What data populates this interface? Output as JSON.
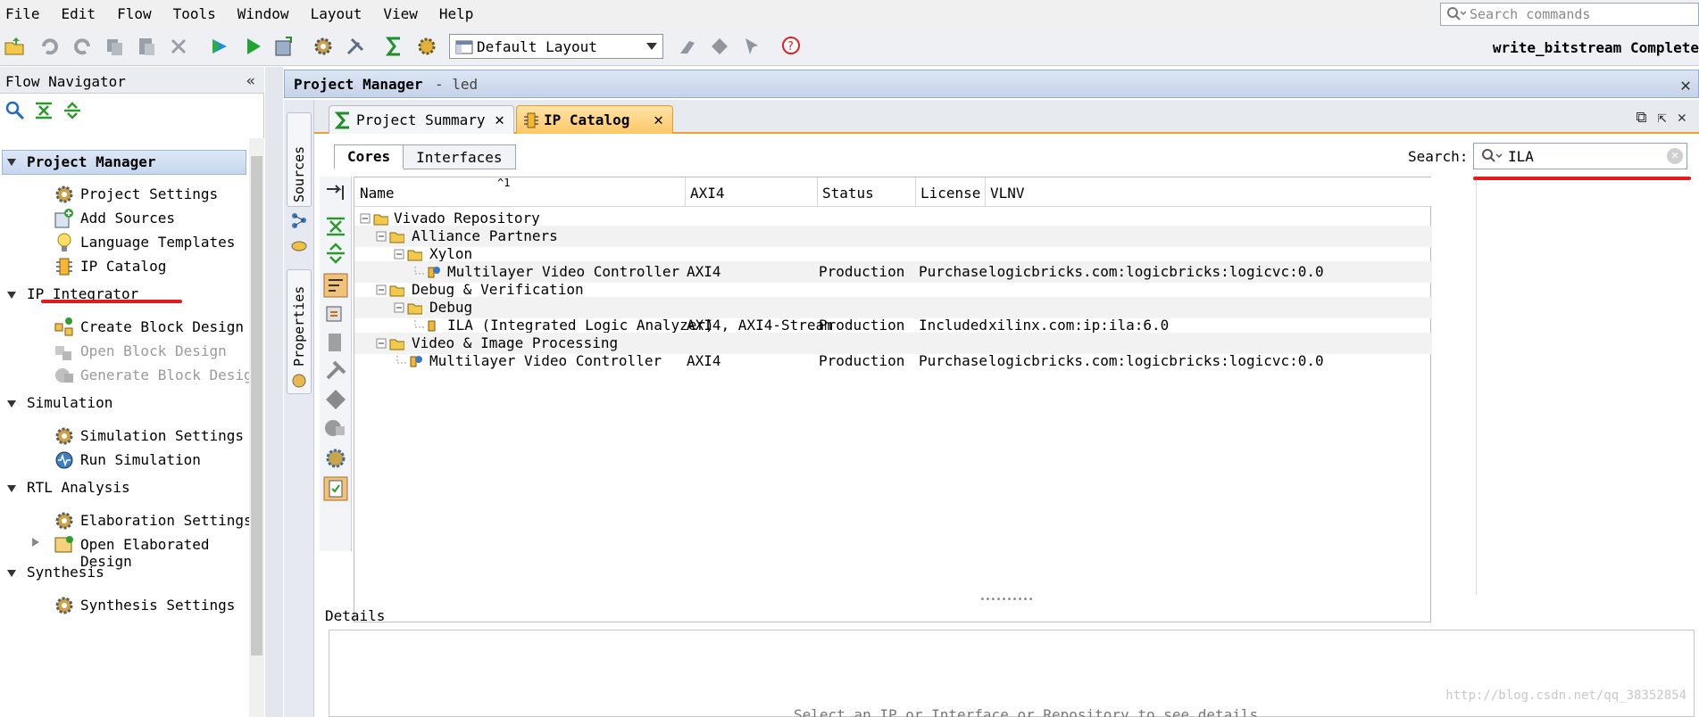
{
  "menu": {
    "items": [
      "File",
      "Edit",
      "Flow",
      "Tools",
      "Window",
      "Layout",
      "View",
      "Help"
    ],
    "search_placeholder": "Search commands"
  },
  "toolbar": {
    "layout_value": "Default Layout",
    "status": "write_bitstream Complete"
  },
  "flow_navigator": {
    "title": "Flow Navigator",
    "collapse_glyph": "«",
    "sections": [
      {
        "label": "Project Manager",
        "items": [
          "Project Settings",
          "Add Sources",
          "Language Templates",
          "IP Catalog"
        ]
      },
      {
        "label": "IP Integrator",
        "items": [
          "Create Block Design",
          "Open Block Design",
          "Generate Block Design"
        ]
      },
      {
        "label": "Simulation",
        "items": [
          "Simulation Settings",
          "Run Simulation"
        ]
      },
      {
        "label": "RTL Analysis",
        "items": [
          "Elaboration Settings",
          "Open Elaborated Design"
        ]
      },
      {
        "label": "Synthesis",
        "items": [
          "Synthesis Settings"
        ]
      }
    ]
  },
  "panel": {
    "title": "Project Manager",
    "subtitle": "- led",
    "side_tabs": [
      "Sources",
      "Properties"
    ],
    "tabs": [
      "Project Summary",
      "IP Catalog"
    ]
  },
  "ip_catalog": {
    "subtabs": [
      "Cores",
      "Interfaces"
    ],
    "search_label": "Search:",
    "search_value": "ILA",
    "sort_indicator": "^1",
    "columns": [
      "Name",
      "AXI4",
      "Status",
      "License",
      "VLNV"
    ],
    "rows": [
      {
        "name": "Vivado Repository",
        "axi": "",
        "status": "",
        "license": "",
        "vlnv": ""
      },
      {
        "name": "Alliance Partners",
        "axi": "",
        "status": "",
        "license": "",
        "vlnv": ""
      },
      {
        "name": "Xylon",
        "axi": "",
        "status": "",
        "license": "",
        "vlnv": ""
      },
      {
        "name": "Multilayer Video Controller",
        "axi": "AXI4",
        "status": "Production",
        "license": "Purchase",
        "vlnv": "logicbricks.com:logicbricks:logicvc:0.0"
      },
      {
        "name": "Debug & Verification",
        "axi": "",
        "status": "",
        "license": "",
        "vlnv": ""
      },
      {
        "name": "Debug",
        "axi": "",
        "status": "",
        "license": "",
        "vlnv": ""
      },
      {
        "name": "ILA (Integrated Logic Analyzer)",
        "axi": "AXI4, AXI4-Stream",
        "status": "Production",
        "license": "Included",
        "vlnv": "xilinx.com:ip:ila:6.0"
      },
      {
        "name": "Video & Image Processing",
        "axi": "",
        "status": "",
        "license": "",
        "vlnv": ""
      },
      {
        "name": "Multilayer Video Controller",
        "axi": "AXI4",
        "status": "Production",
        "license": "Purchase",
        "vlnv": "logicbricks.com:logicbricks:logicvc:0.0"
      }
    ],
    "details_label": "Details",
    "details_message": "Select an IP or Interface or Repository to see details"
  },
  "watermark": "http://blog.csdn.net/qq_38352854",
  "colors": {
    "accent": "#f0a030",
    "annotation": "#e21c1c",
    "selection": "#c6d7ee"
  }
}
